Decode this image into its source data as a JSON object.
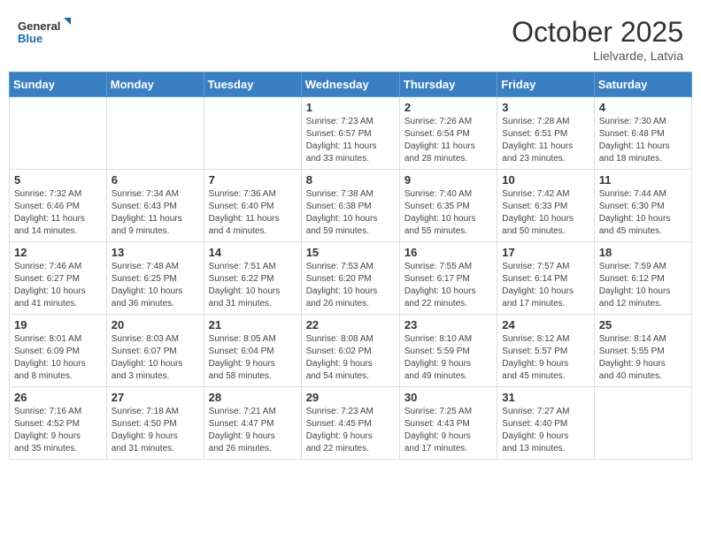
{
  "logo": {
    "line1": "General",
    "line2": "Blue"
  },
  "title": "October 2025",
  "location": "Lielvarde, Latvia",
  "days_of_week": [
    "Sunday",
    "Monday",
    "Tuesday",
    "Wednesday",
    "Thursday",
    "Friday",
    "Saturday"
  ],
  "weeks": [
    [
      {
        "day": "",
        "info": ""
      },
      {
        "day": "",
        "info": ""
      },
      {
        "day": "",
        "info": ""
      },
      {
        "day": "1",
        "info": "Sunrise: 7:23 AM\nSunset: 6:57 PM\nDaylight: 11 hours\nand 33 minutes."
      },
      {
        "day": "2",
        "info": "Sunrise: 7:26 AM\nSunset: 6:54 PM\nDaylight: 11 hours\nand 28 minutes."
      },
      {
        "day": "3",
        "info": "Sunrise: 7:28 AM\nSunset: 6:51 PM\nDaylight: 11 hours\nand 23 minutes."
      },
      {
        "day": "4",
        "info": "Sunrise: 7:30 AM\nSunset: 6:48 PM\nDaylight: 11 hours\nand 18 minutes."
      }
    ],
    [
      {
        "day": "5",
        "info": "Sunrise: 7:32 AM\nSunset: 6:46 PM\nDaylight: 11 hours\nand 14 minutes."
      },
      {
        "day": "6",
        "info": "Sunrise: 7:34 AM\nSunset: 6:43 PM\nDaylight: 11 hours\nand 9 minutes."
      },
      {
        "day": "7",
        "info": "Sunrise: 7:36 AM\nSunset: 6:40 PM\nDaylight: 11 hours\nand 4 minutes."
      },
      {
        "day": "8",
        "info": "Sunrise: 7:38 AM\nSunset: 6:38 PM\nDaylight: 10 hours\nand 59 minutes."
      },
      {
        "day": "9",
        "info": "Sunrise: 7:40 AM\nSunset: 6:35 PM\nDaylight: 10 hours\nand 55 minutes."
      },
      {
        "day": "10",
        "info": "Sunrise: 7:42 AM\nSunset: 6:33 PM\nDaylight: 10 hours\nand 50 minutes."
      },
      {
        "day": "11",
        "info": "Sunrise: 7:44 AM\nSunset: 6:30 PM\nDaylight: 10 hours\nand 45 minutes."
      }
    ],
    [
      {
        "day": "12",
        "info": "Sunrise: 7:46 AM\nSunset: 6:27 PM\nDaylight: 10 hours\nand 41 minutes."
      },
      {
        "day": "13",
        "info": "Sunrise: 7:48 AM\nSunset: 6:25 PM\nDaylight: 10 hours\nand 36 minutes."
      },
      {
        "day": "14",
        "info": "Sunrise: 7:51 AM\nSunset: 6:22 PM\nDaylight: 10 hours\nand 31 minutes."
      },
      {
        "day": "15",
        "info": "Sunrise: 7:53 AM\nSunset: 6:20 PM\nDaylight: 10 hours\nand 26 minutes."
      },
      {
        "day": "16",
        "info": "Sunrise: 7:55 AM\nSunset: 6:17 PM\nDaylight: 10 hours\nand 22 minutes."
      },
      {
        "day": "17",
        "info": "Sunrise: 7:57 AM\nSunset: 6:14 PM\nDaylight: 10 hours\nand 17 minutes."
      },
      {
        "day": "18",
        "info": "Sunrise: 7:59 AM\nSunset: 6:12 PM\nDaylight: 10 hours\nand 12 minutes."
      }
    ],
    [
      {
        "day": "19",
        "info": "Sunrise: 8:01 AM\nSunset: 6:09 PM\nDaylight: 10 hours\nand 8 minutes."
      },
      {
        "day": "20",
        "info": "Sunrise: 8:03 AM\nSunset: 6:07 PM\nDaylight: 10 hours\nand 3 minutes."
      },
      {
        "day": "21",
        "info": "Sunrise: 8:05 AM\nSunset: 6:04 PM\nDaylight: 9 hours\nand 58 minutes."
      },
      {
        "day": "22",
        "info": "Sunrise: 8:08 AM\nSunset: 6:02 PM\nDaylight: 9 hours\nand 54 minutes."
      },
      {
        "day": "23",
        "info": "Sunrise: 8:10 AM\nSunset: 5:59 PM\nDaylight: 9 hours\nand 49 minutes."
      },
      {
        "day": "24",
        "info": "Sunrise: 8:12 AM\nSunset: 5:57 PM\nDaylight: 9 hours\nand 45 minutes."
      },
      {
        "day": "25",
        "info": "Sunrise: 8:14 AM\nSunset: 5:55 PM\nDaylight: 9 hours\nand 40 minutes."
      }
    ],
    [
      {
        "day": "26",
        "info": "Sunrise: 7:16 AM\nSunset: 4:52 PM\nDaylight: 9 hours\nand 35 minutes."
      },
      {
        "day": "27",
        "info": "Sunrise: 7:18 AM\nSunset: 4:50 PM\nDaylight: 9 hours\nand 31 minutes."
      },
      {
        "day": "28",
        "info": "Sunrise: 7:21 AM\nSunset: 4:47 PM\nDaylight: 9 hours\nand 26 minutes."
      },
      {
        "day": "29",
        "info": "Sunrise: 7:23 AM\nSunset: 4:45 PM\nDaylight: 9 hours\nand 22 minutes."
      },
      {
        "day": "30",
        "info": "Sunrise: 7:25 AM\nSunset: 4:43 PM\nDaylight: 9 hours\nand 17 minutes."
      },
      {
        "day": "31",
        "info": "Sunrise: 7:27 AM\nSunset: 4:40 PM\nDaylight: 9 hours\nand 13 minutes."
      },
      {
        "day": "",
        "info": ""
      }
    ]
  ]
}
